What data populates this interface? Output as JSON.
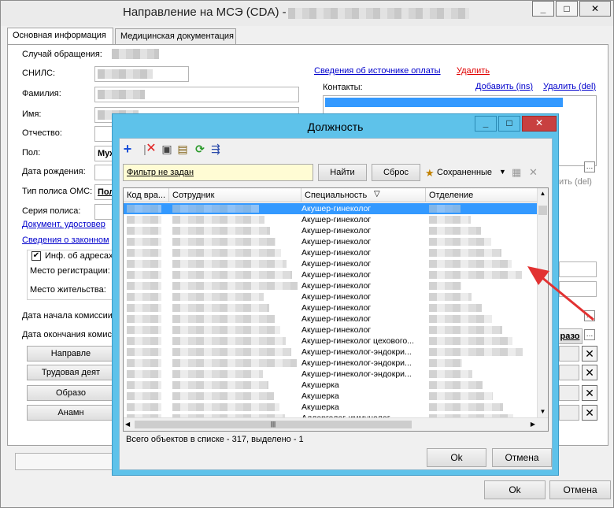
{
  "main": {
    "title": "Направление на МСЭ (CDA) -",
    "tabs": [
      "Основная информация",
      "Медицинская документация"
    ],
    "labels": {
      "case": "Случай обращения:",
      "snils": "СНИЛС:",
      "lastname": "Фамилия:",
      "firstname": "Имя:",
      "patronymic": "Отчество:",
      "sex": "Пол:",
      "sex_value": "Муж",
      "birth": "Дата рождения:",
      "oms_type": "Тип полиса ОМС:",
      "oms_type_value": "Пол",
      "series": "Серия полиса:",
      "doc_link": "Документ, удостовер",
      "law_link": "Сведения о законном",
      "address_check": "Инф. об адресах",
      "reg_place": "Место регистрации:",
      "live_place": "Место жительства:",
      "comm_start": "Дата начала комиссии",
      "comm_end": "Дата окончания комис",
      "payment_link": "Сведения об источнике оплаты",
      "delete": "Удалить",
      "contacts": "Контакты:",
      "add_ins": "Добавить (ins)",
      "del_del": "Удалить (del)",
      "del_del2": "ить (del)",
      "edu_short": "разо"
    },
    "side_buttons": [
      "Направле",
      "Трудовая деят",
      "Образо",
      "Анамн"
    ],
    "ok": "Ok",
    "cancel": "Отмена"
  },
  "dialog": {
    "title": "Должность",
    "filter_text": "Фильтр не задан",
    "find": "Найти",
    "reset": "Сброс",
    "saved": "Сохраненные",
    "columns": [
      "Код вра...",
      "Сотрудник",
      "Специальность",
      "Отделение"
    ],
    "specialties": [
      "Акушер-гинеколог",
      "Акушер-гинеколог",
      "Акушер-гинеколог",
      "Акушер-гинеколог",
      "Акушер-гинеколог",
      "Акушер-гинеколог",
      "Акушер-гинеколог",
      "Акушер-гинеколог",
      "Акушер-гинеколог",
      "Акушер-гинеколог",
      "Акушер-гинеколог",
      "Акушер-гинеколог",
      "Акушер-гинеколог цехового...",
      "Акушер-гинеколог-эндокри...",
      "Акушер-гинеколог-эндокри...",
      "Акушер-гинеколог-эндокри...",
      "Акушерка",
      "Акушерка",
      "Акушерка",
      "Аллерголог-иммунолог"
    ],
    "status": "Всего объектов в списке - 317, выделено - 1",
    "ok": "Ok",
    "cancel": "Отмена"
  },
  "colors": {
    "dialog_frame": "#5ec2ea",
    "selection": "#3399ff",
    "arrow": "#e23232",
    "link": "#0000cc"
  }
}
